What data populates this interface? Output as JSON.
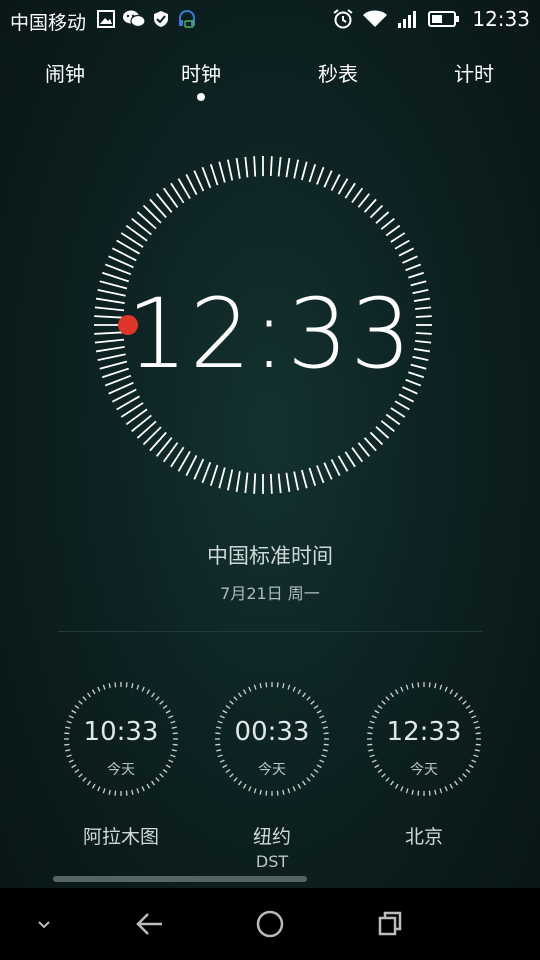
{
  "status_bar": {
    "carrier": "中国移动",
    "time": "12:33",
    "icons": [
      "image-icon",
      "wechat-icon",
      "shield-icon",
      "headset-icon",
      "alarm-icon",
      "wifi-icon",
      "signal-icon",
      "battery-icon"
    ]
  },
  "tabs": [
    {
      "label": "闹钟",
      "active": false
    },
    {
      "label": "时钟",
      "active": true
    },
    {
      "label": "秒表",
      "active": false
    },
    {
      "label": "计时",
      "active": false
    }
  ],
  "main_clock": {
    "time": "12:33",
    "zone": "中国标准时间",
    "date": "7月21日 周一",
    "second_indicator_color": "#e0352b"
  },
  "world_clocks": [
    {
      "time": "10:33",
      "day": "今天",
      "city": "阿拉木图",
      "dst": ""
    },
    {
      "time": "00:33",
      "day": "今天",
      "city": "纽约",
      "dst": "DST"
    },
    {
      "time": "12:33",
      "day": "今天",
      "city": "北京",
      "dst": ""
    }
  ],
  "navbar": {
    "icons": [
      "chevron-down-icon",
      "back-icon",
      "home-icon",
      "recents-icon"
    ]
  }
}
